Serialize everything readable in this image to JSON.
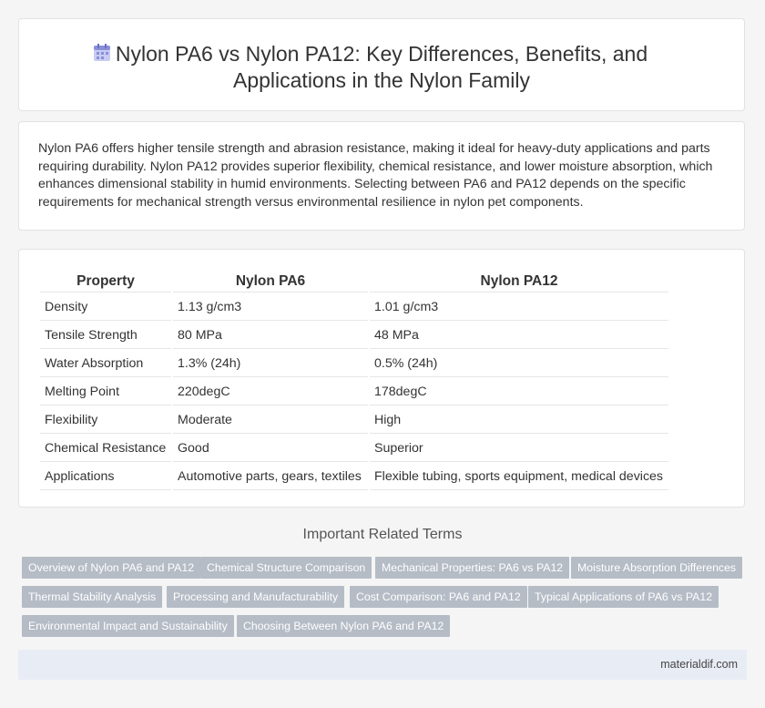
{
  "header": {
    "title_line1": "Nylon PA6 vs Nylon PA12: Key Differences, Benefits, and",
    "title_line2": "Applications in the Nylon Family",
    "icon": "calendar-icon",
    "icon_color": "#8a8fd8"
  },
  "summary": {
    "text": "Nylon PA6 offers higher tensile strength and abrasion resistance, making it ideal for heavy-duty applications and parts requiring durability. Nylon PA12 provides superior flexibility, chemical resistance, and lower moisture absorption, which enhances dimensional stability in humid environments. Selecting between PA6 and PA12 depends on the specific requirements for mechanical strength versus environmental resilience in nylon pet components."
  },
  "table": {
    "headers": [
      "Property",
      "Nylon PA6",
      "Nylon PA12"
    ],
    "rows": [
      [
        "Density",
        "1.13 g/cm3",
        "1.01 g/cm3"
      ],
      [
        "Tensile Strength",
        "80 MPa",
        "48 MPa"
      ],
      [
        "Water Absorption",
        "1.3% (24h)",
        "0.5% (24h)"
      ],
      [
        "Melting Point",
        "220degC",
        "178degC"
      ],
      [
        "Flexibility",
        "Moderate",
        "High"
      ],
      [
        "Chemical Resistance",
        "Good",
        "Superior"
      ],
      [
        "Applications",
        "Automotive parts, gears, textiles",
        "Flexible tubing, sports equipment, medical devices"
      ]
    ]
  },
  "related": {
    "title": "Important Related Terms",
    "tags": [
      "Overview of Nylon PA6 and PA12",
      "Chemical Structure Comparison",
      "Mechanical Properties: PA6 vs PA12",
      "Moisture Absorption Differences",
      "Thermal Stability Analysis",
      "Processing and Manufacturability",
      "Cost Comparison: PA6 and PA12",
      "Typical Applications of PA6 vs PA12",
      "Environmental Impact and Sustainability",
      "Choosing Between Nylon PA6 and PA12"
    ]
  },
  "footer": {
    "site": "materialdif.com"
  }
}
